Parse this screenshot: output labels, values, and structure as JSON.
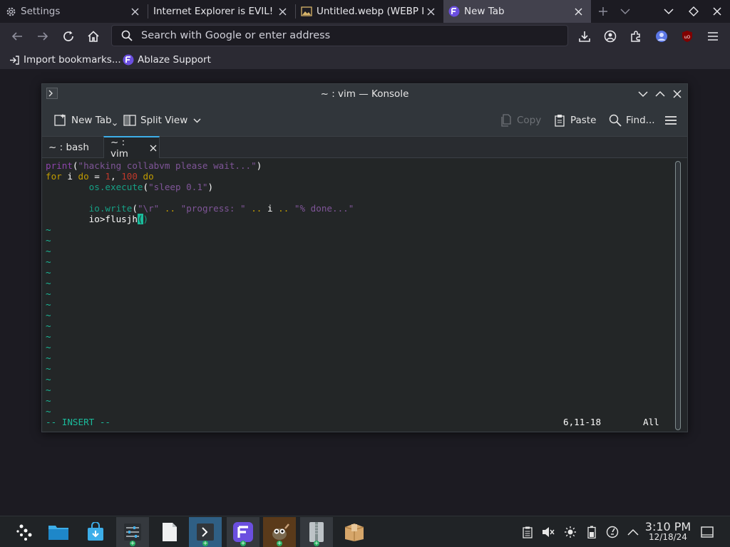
{
  "browser": {
    "tabs": [
      {
        "title": "Settings",
        "icon": "gear-icon"
      },
      {
        "title": "Internet Explorer is EVIL!",
        "icon": "none"
      },
      {
        "title": "Untitled.webp (WEBP Im",
        "icon": "image-icon"
      },
      {
        "title": "New Tab",
        "icon": "ablaze-logo-icon"
      }
    ],
    "url_placeholder": "Search with Google or enter address",
    "bookmarks": [
      {
        "label": "Import bookmarks...",
        "icon": "import-icon"
      },
      {
        "label": "Ablaze Support",
        "icon": "ablaze-logo-icon"
      }
    ]
  },
  "konsole": {
    "window_title": "~ : vim — Konsole",
    "toolbar": {
      "new_tab": "New Tab",
      "split_view": "Split View",
      "copy": "Copy",
      "paste": "Paste",
      "find": "Find..."
    },
    "tabs": [
      {
        "label": "~ : bash"
      },
      {
        "label": "~ : vim"
      }
    ],
    "editor": {
      "line1": {
        "fn": "print",
        "p1": "(",
        "str": "\"hacking collabvm please wait...\"",
        "p2": ")"
      },
      "line2": {
        "k1": "for",
        "t1": " i ",
        "k2": "do",
        "t2": " = ",
        "n1": "1",
        "t3": ", ",
        "n2": "100",
        "t4": " ",
        "k3": "do"
      },
      "line3": {
        "indent": "        ",
        "fn": "os.execute",
        "p1": "(",
        "str": "\"sleep 0.1\"",
        "p2": ")"
      },
      "line5": {
        "indent": "        ",
        "fn": "io.write",
        "p1": "(",
        "s1": "\"\\r\"",
        "o1": " .. ",
        "s2": "\"progress: \"",
        "o2": " .. ",
        "v": "i",
        "o3": " .. ",
        "s3": "\"% done...\""
      },
      "line6": {
        "indent": "        ",
        "text": "io>flusjh",
        "cur1": "(",
        "cur2": ")"
      },
      "tilde": "~",
      "mode": "-- INSERT --",
      "position": "6,11-18",
      "scroll": "All"
    }
  },
  "taskbar": {
    "time": "3:10 PM",
    "date": "12/18/24"
  }
}
